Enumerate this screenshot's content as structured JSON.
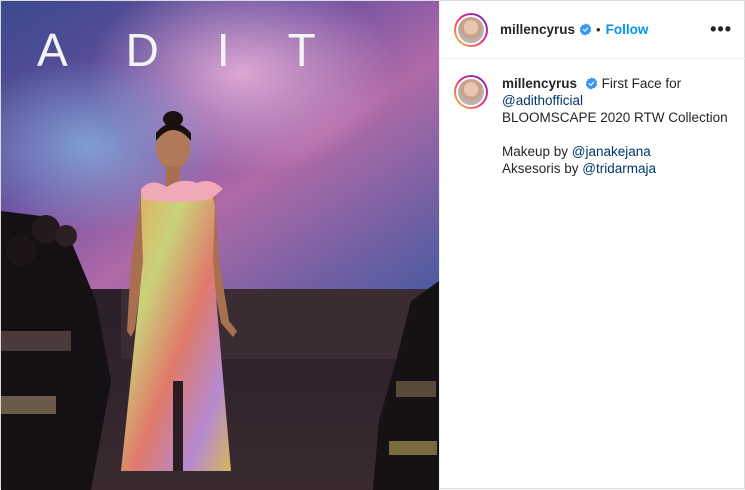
{
  "post": {
    "image": {
      "brand_text": "ADIT",
      "alt": "Runway model in floral gown"
    },
    "header": {
      "username": "millencyrus",
      "separator": "•",
      "follow_label": "Follow",
      "more_label": "•••"
    },
    "caption": {
      "username": "millencyrus",
      "text_1": "First Face for",
      "mention_1": "@adithofficial",
      "text_2": "BLOOMSCAPE 2020 RTW Collection",
      "text_3_prefix": "Makeup by ",
      "mention_2": "@janakejana",
      "text_4_prefix": "Aksesoris by ",
      "mention_3": "@tridarmaja"
    }
  },
  "colors": {
    "follow_blue": "#0095f6",
    "verified_blue": "#3897f0",
    "mention": "#00376b",
    "text": "#262626",
    "border": "#dbdbdb"
  },
  "icons": [
    "verified-badge-icon",
    "more-options-icon"
  ]
}
